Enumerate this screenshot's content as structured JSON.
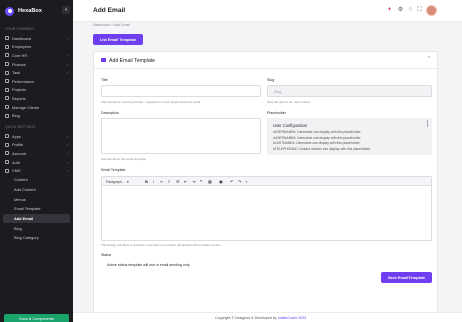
{
  "app": {
    "brand": "HexaBox"
  },
  "sidebar": {
    "section_main": "YOUR COMPANY",
    "main_items": [
      {
        "label": "Dashboard",
        "icon": "grid-icon",
        "has_chevron": true
      },
      {
        "label": "Employees",
        "icon": "users-icon",
        "has_chevron": false
      },
      {
        "label": "Core HR",
        "icon": "briefcase-icon",
        "has_chevron": true
      },
      {
        "label": "Finance",
        "icon": "wallet-icon",
        "has_chevron": true
      },
      {
        "label": "Task",
        "icon": "task-icon",
        "has_chevron": true
      },
      {
        "label": "Performance",
        "icon": "chart-icon",
        "has_chevron": false
      },
      {
        "label": "Projects",
        "icon": "folder-icon",
        "has_chevron": false
      },
      {
        "label": "Reports",
        "icon": "report-icon",
        "has_chevron": false
      },
      {
        "label": "Manage Clients",
        "icon": "client-icon",
        "has_chevron": false
      },
      {
        "label": "Blog",
        "icon": "blog-icon",
        "has_chevron": false
      }
    ],
    "section_system": "QUICK SETTINGS",
    "system_items": [
      {
        "label": "Apps",
        "icon": "apps-icon",
        "has_chevron": true
      },
      {
        "label": "Profile",
        "icon": "profile-icon",
        "has_chevron": true
      },
      {
        "label": "Account",
        "icon": "account-icon",
        "has_chevron": true
      },
      {
        "label": "Auth",
        "icon": "lock-icon",
        "has_chevron": true
      },
      {
        "label": "CMS",
        "icon": "cms-icon",
        "has_chevron": true
      }
    ],
    "cms_sub_items": [
      {
        "label": "Content",
        "active": false
      },
      {
        "label": "Add Content",
        "active": false
      },
      {
        "label": "Menus",
        "active": false
      },
      {
        "label": "Email Template",
        "active": false
      },
      {
        "label": "Add Email",
        "active": true
      },
      {
        "label": "Blog",
        "active": false
      },
      {
        "label": "Blog Category",
        "active": false
      }
    ],
    "cta_label": "Docs & Components"
  },
  "header": {
    "title": "Add Email"
  },
  "breadcrumb": "Dashboard  >  Add Email",
  "list_button": "List Email Template",
  "card": {
    "title": "Add Email Template",
    "title_label": "Title",
    "title_help": "This should be meaning full title - regarded to email, forgot password email.",
    "slug_label": "Slug",
    "slug_placeholder": "Slug",
    "slug_help": "Slug will use for url. Can't edited.",
    "description_label": "Description",
    "description_help": "Use few about the email template.",
    "placeholder_label": "Placeholder",
    "placeholder_box": {
      "title": "User Configuration",
      "lines": [
        "#USERNAME#: Username can display with this placeholder.",
        "#USERNAME#: Username can display with this placeholder.",
        "#LASTNAME#: Username can display with this placeholder.",
        "#TELEPHONE#: Contact number can display with this placeholder."
      ]
    },
    "email_template_label": "Email Template",
    "editor": {
      "format_select": "Paragraph",
      "toolbar_icons": [
        "bold-icon",
        "italic-icon",
        "link-icon",
        "list-icon",
        "numbered-list-icon",
        "outdent-icon",
        "indent-icon",
        "quote-icon",
        "table-icon",
        "media-icon",
        "undo-icon",
        "redo-icon",
        "image-icon"
      ]
    },
    "editor_help": "This design will allow to selected email and send mailers will applied with template content.",
    "status_label": "Status",
    "status_text": "Active status template will use in email sending only.",
    "save_button": "Save EmailTemplate"
  },
  "footer": {
    "text": "Copyright © Designed & Developed by ",
    "link": "IndianCoder 2023"
  },
  "colors": {
    "accent": "#6d3ff0",
    "sidebar_bg": "#1b1b20",
    "cta_green": "#1aa36b"
  }
}
